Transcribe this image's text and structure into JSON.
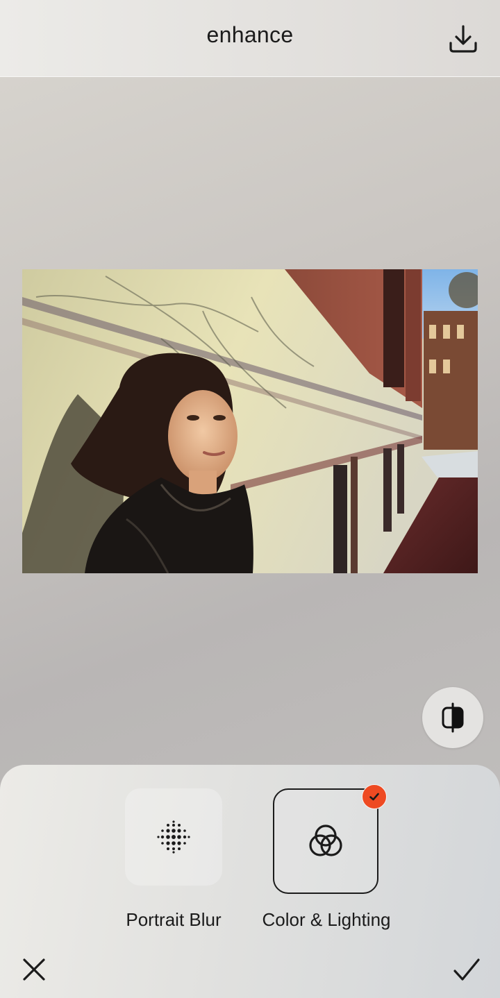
{
  "header": {
    "title": "enhance",
    "download_icon": "download-icon"
  },
  "photo": {
    "description_icon": "photo-preview"
  },
  "compare": {
    "icon": "compare-split-icon"
  },
  "tools": [
    {
      "label": "Portrait Blur",
      "icon": "dot-grid-icon",
      "selected": false
    },
    {
      "label": "Color & Lighting",
      "icon": "interlinked-rings-icon",
      "selected": true
    }
  ],
  "actions": {
    "cancel_icon": "close-icon",
    "apply_icon": "checkmark-icon"
  },
  "colors": {
    "accent": "#ee4a22",
    "text": "#1b1b1b"
  }
}
